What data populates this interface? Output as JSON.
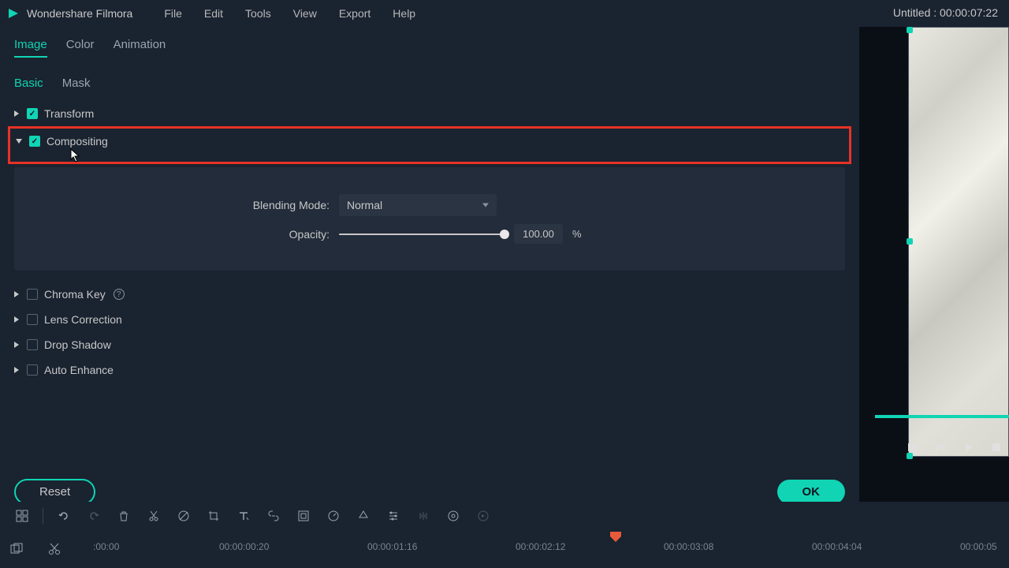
{
  "app_name": "Wondershare Filmora",
  "project_title": "Untitled : 00:00:07:22",
  "menu": {
    "file": "File",
    "edit": "Edit",
    "tools": "Tools",
    "view": "View",
    "export": "Export",
    "help": "Help"
  },
  "tabs": {
    "image": "Image",
    "color": "Color",
    "animation": "Animation"
  },
  "subtabs": {
    "basic": "Basic",
    "mask": "Mask"
  },
  "panels": {
    "transform": "Transform",
    "compositing": "Compositing",
    "chroma": "Chroma Key",
    "lens": "Lens Correction",
    "drop": "Drop Shadow",
    "auto": "Auto Enhance"
  },
  "compositing": {
    "blend_label": "Blending Mode:",
    "blend_value": "Normal",
    "opacity_label": "Opacity:",
    "opacity_value": "100.00",
    "opacity_unit": "%"
  },
  "buttons": {
    "reset": "Reset",
    "ok": "OK"
  },
  "timeline": {
    "ticks": [
      ":00:00",
      "00:00:00:20",
      "00:00:01:16",
      "00:00:02:12",
      "00:00:03:08",
      "00:00:04:04",
      "00:00:05"
    ]
  }
}
